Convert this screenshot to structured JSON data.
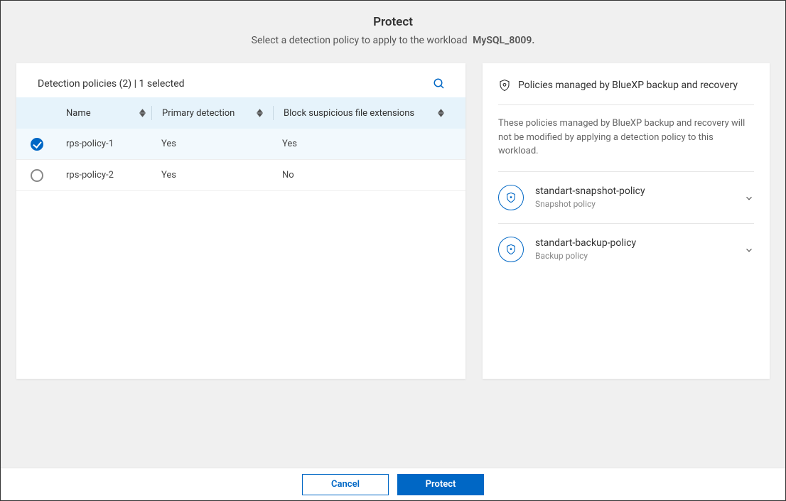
{
  "header": {
    "title": "Protect",
    "subtitle_prefix": "Select a detection policy to apply to the workload",
    "workload_name": "MySQL_8009."
  },
  "left_panel": {
    "title": "Detection policies (2) | 1 selected",
    "columns": {
      "name": "Name",
      "primary": "Primary detection",
      "block": "Block suspicious file extensions"
    },
    "rows": [
      {
        "name": "rps-policy-1",
        "primary": "Yes",
        "block": "Yes",
        "selected": true
      },
      {
        "name": "rps-policy-2",
        "primary": "Yes",
        "block": "No",
        "selected": false
      }
    ]
  },
  "right_panel": {
    "heading": "Policies managed by BlueXP backup and recovery",
    "description": "These policies managed by BlueXP backup and recovery will not be modified by applying a detection policy to this workload.",
    "policies": [
      {
        "name": "standart-snapshot-policy",
        "type": "Snapshot policy"
      },
      {
        "name": "standart-backup-policy",
        "type": "Backup policy"
      }
    ]
  },
  "footer": {
    "cancel": "Cancel",
    "protect": "Protect"
  }
}
